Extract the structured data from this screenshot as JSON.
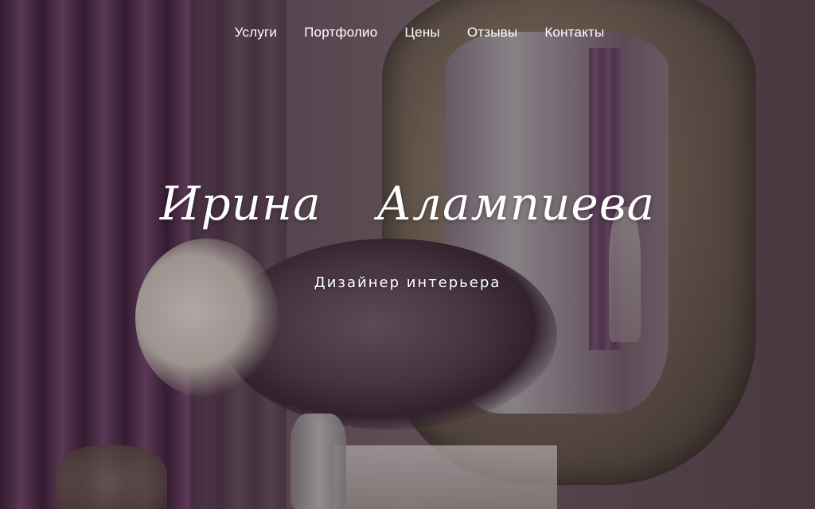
{
  "nav": {
    "items": [
      {
        "label": "Услуги"
      },
      {
        "label": "Портфолио"
      },
      {
        "label": "Цены"
      },
      {
        "label": "Отзывы"
      },
      {
        "label": "Контакты"
      }
    ]
  },
  "hero": {
    "name": "Ирина Алампиева",
    "subtitle": "Дизайнер интерьера"
  },
  "colors": {
    "text": "#ffffff",
    "curtain": "#5b3356"
  }
}
